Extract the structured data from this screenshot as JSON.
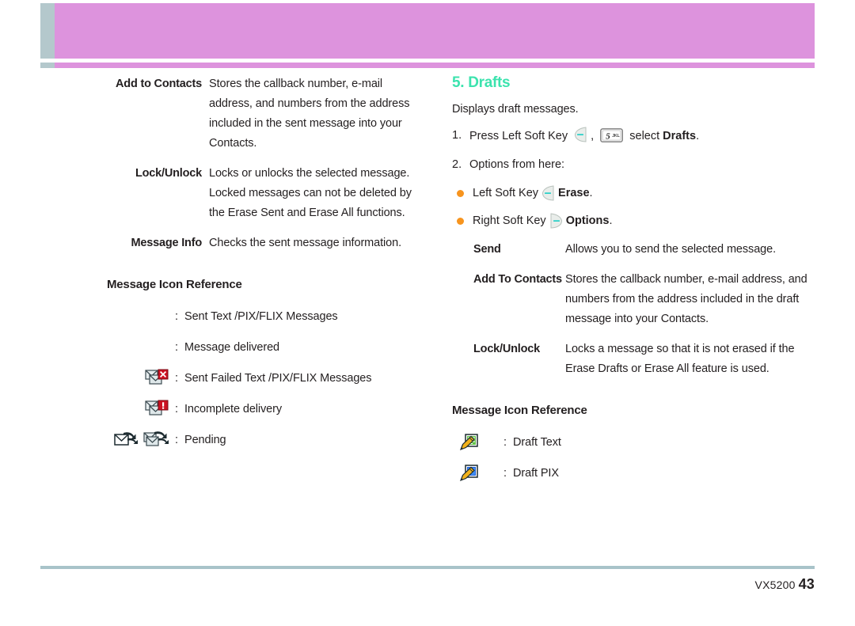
{
  "page": {
    "footer_model": "VX5200",
    "footer_page": "43",
    "accent_header": "#dd93dd",
    "accent_tab": "#b4c8cc",
    "accent_heading": "#3ce3ae",
    "accent_bullet": "#f7941e",
    "accent_rule": "#a8c3c9"
  },
  "left": {
    "options": [
      {
        "term": "Add to Contacts",
        "desc": "Stores the callback number, e-mail address, and numbers from the address included in the sent message into your Contacts."
      },
      {
        "term": "Lock/Unlock",
        "desc": "Locks or unlocks the selected message. Locked messages can not be deleted by the Erase Sent and Erase All functions."
      },
      {
        "term": "Message Info",
        "desc": "Checks the sent message information."
      }
    ],
    "icon_reference_heading": "Message Icon Reference",
    "icon_rows": [
      {
        "icons": [
          "sent-message-icon"
        ],
        "colon": ":",
        "label": "Sent Text /PIX/FLIX Messages"
      },
      {
        "icons": [
          "message-delivered-icon"
        ],
        "colon": ":",
        "label": "Message delivered"
      },
      {
        "icons": [
          "sent-failed-icon"
        ],
        "colon": ":",
        "label": "Sent Failed Text /PIX/FLIX Messages"
      },
      {
        "icons": [
          "incomplete-delivery-icon"
        ],
        "colon": ":",
        "label": "Incomplete delivery"
      },
      {
        "icons": [
          "pending-single-icon",
          "pending-multi-icon"
        ],
        "colon": ":",
        "label": "Pending"
      }
    ]
  },
  "right": {
    "chapter_title": "5. Drafts",
    "intro": "Displays draft messages.",
    "steps": [
      {
        "num": "1.",
        "pre": "Press Left Soft Key",
        "key_label": "5",
        "key_sup": "JKL",
        "mid": "select",
        "bold": "Drafts",
        "post": "."
      },
      {
        "num": "2.",
        "text": "Options from here:"
      }
    ],
    "bullets": [
      {
        "pre": "Left Soft Key",
        "icon": "left-soft-key-icon",
        "bold": "Erase",
        "post": "."
      },
      {
        "pre": "Right Soft Key",
        "icon": "right-soft-key-icon",
        "bold": "Options",
        "post": "."
      }
    ],
    "options": [
      {
        "term": "Send",
        "desc": "Allows you to send the selected message."
      },
      {
        "term": "Add To Contacts",
        "desc": "Stores the callback number, e-mail address, and numbers from the address included in the draft message into your Contacts."
      },
      {
        "term": "Lock/Unlock",
        "desc": "Locks a message so that it is not erased if the Erase Drafts or Erase All feature is used."
      }
    ],
    "icon_reference_heading": "Message Icon Reference",
    "icon_rows": [
      {
        "icons": [
          "draft-text-icon"
        ],
        "colon": ":",
        "label": "Draft Text"
      },
      {
        "icons": [
          "draft-pix-icon"
        ],
        "colon": ":",
        "label": "Draft PIX"
      }
    ]
  }
}
